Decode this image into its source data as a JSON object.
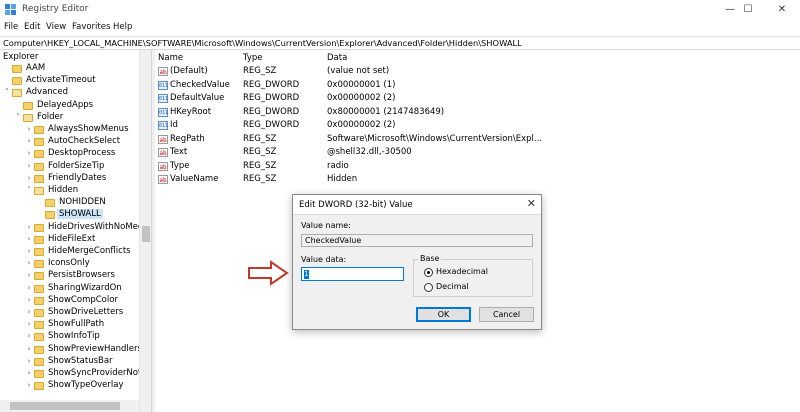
{
  "window": {
    "title": "Registry Editor",
    "controls": {
      "minimize": "—",
      "maximize": "☐",
      "close": "✕"
    }
  },
  "menu": [
    "File",
    "Edit",
    "View",
    "Favorites",
    "Help"
  ],
  "address": "Computer\\HKEY_LOCAL_MACHINE\\SOFTWARE\\Microsoft\\Windows\\CurrentVersion\\Explorer\\Advanced\\Folder\\Hidden\\SHOWALL",
  "tree": {
    "header": "Explorer",
    "nodes": [
      {
        "label": "AAM",
        "expander": ""
      },
      {
        "label": "ActivateTimeout",
        "expander": ""
      },
      {
        "label": "Advanced",
        "expander": "˅"
      },
      {
        "label": "DelayedApps",
        "expander": ""
      },
      {
        "label": "Folder",
        "expander": "˅"
      },
      {
        "label": "AlwaysShowMenus",
        "expander": "›"
      },
      {
        "label": "AutoCheckSelect",
        "expander": "›"
      },
      {
        "label": "DesktopProcess",
        "expander": "›"
      },
      {
        "label": "FolderSizeTip",
        "expander": "›"
      },
      {
        "label": "FriendlyDates",
        "expander": "›"
      },
      {
        "label": "Hidden",
        "expander": "˅"
      },
      {
        "label": "NOHIDDEN",
        "expander": ""
      },
      {
        "label": "SHOWALL",
        "expander": ""
      },
      {
        "label": "HideDrivesWithNoMedia",
        "expander": "›"
      },
      {
        "label": "HideFileExt",
        "expander": "›"
      },
      {
        "label": "HideMergeConflicts",
        "expander": "›"
      },
      {
        "label": "IconsOnly",
        "expander": "›"
      },
      {
        "label": "PersistBrowsers",
        "expander": "›"
      },
      {
        "label": "SharingWizardOn",
        "expander": "›"
      },
      {
        "label": "ShowCompColor",
        "expander": "›"
      },
      {
        "label": "ShowDriveLetters",
        "expander": "›"
      },
      {
        "label": "ShowFullPath",
        "expander": "›"
      },
      {
        "label": "ShowInfoTip",
        "expander": "›"
      },
      {
        "label": "ShowPreviewHandlers",
        "expander": "›"
      },
      {
        "label": "ShowStatusBar",
        "expander": "›"
      },
      {
        "label": "ShowSyncProviderNotificat",
        "expander": "›"
      },
      {
        "label": "ShowTypeOverlay",
        "expander": "›"
      }
    ]
  },
  "list": {
    "columns": {
      "name": "Name",
      "type": "Type",
      "data": "Data"
    },
    "rows": [
      {
        "name": "(Default)",
        "type": "REG_SZ",
        "data": "(value not set)",
        "icon": "ab"
      },
      {
        "name": "CheckedValue",
        "type": "REG_DWORD",
        "data": "0x00000001 (1)",
        "icon": "011"
      },
      {
        "name": "DefaultValue",
        "type": "REG_DWORD",
        "data": "0x00000002 (2)",
        "icon": "011"
      },
      {
        "name": "HKeyRoot",
        "type": "REG_DWORD",
        "data": "0x80000001 (2147483649)",
        "icon": "011"
      },
      {
        "name": "Id",
        "type": "REG_DWORD",
        "data": "0x00000002 (2)",
        "icon": "011"
      },
      {
        "name": "RegPath",
        "type": "REG_SZ",
        "data": "Software\\Microsoft\\Windows\\CurrentVersion\\Expl...",
        "icon": "ab"
      },
      {
        "name": "Text",
        "type": "REG_SZ",
        "data": "@shell32.dll,-30500",
        "icon": "ab"
      },
      {
        "name": "Type",
        "type": "REG_SZ",
        "data": "radio",
        "icon": "ab"
      },
      {
        "name": "ValueName",
        "type": "REG_SZ",
        "data": "Hidden",
        "icon": "ab"
      }
    ]
  },
  "dialog": {
    "title": "Edit DWORD (32-bit) Value",
    "close": "✕",
    "value_name_label": "Value name:",
    "value_name": "CheckedValue",
    "value_data_label": "Value data:",
    "value_data": "1",
    "base_label": "Base",
    "hex_label": "Hexadecimal",
    "dec_label": "Decimal",
    "base_selected": "Hexadecimal",
    "ok": "OK",
    "cancel": "Cancel"
  },
  "colors": {
    "selection": "#cce4f7",
    "accent": "#0078d7",
    "arrow": "#c0392b",
    "folder": "#f3d06b"
  }
}
